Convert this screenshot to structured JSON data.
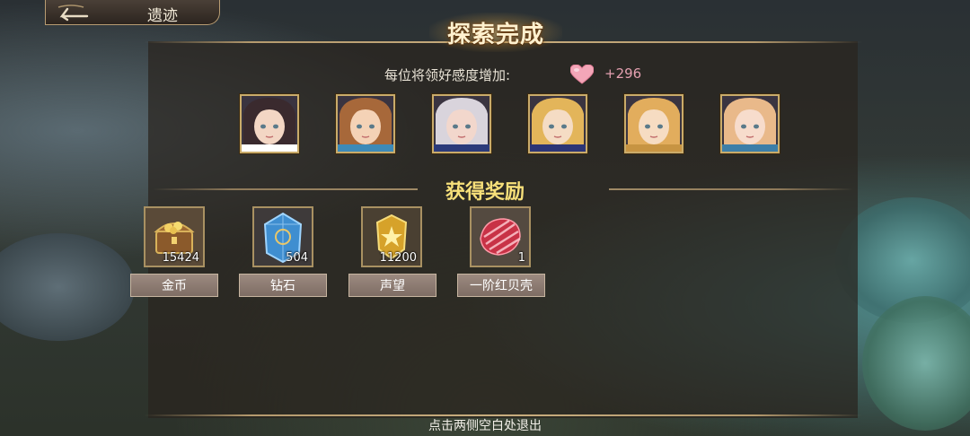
{
  "header": {
    "back_icon": "back-arrow-icon",
    "area_title": "遗迹"
  },
  "banner": {
    "title": "探索完成"
  },
  "affection": {
    "label": "每位将领好感度增加:",
    "icon": "heart-icon",
    "value": "+296"
  },
  "portraits": [
    {
      "name": "portrait-1",
      "hair": "#3a2a2e",
      "skin": "#f3d6c4",
      "accent": "#ffffff"
    },
    {
      "name": "portrait-2",
      "hair": "#a7683a",
      "skin": "#f4d2b6",
      "accent": "#3d8ab8"
    },
    {
      "name": "portrait-3",
      "hair": "#d9d4dc",
      "skin": "#f2d7cc",
      "accent": "#2b3a7a"
    },
    {
      "name": "portrait-4",
      "hair": "#e3b55a",
      "skin": "#f5dcc4",
      "accent": "#2c3576"
    },
    {
      "name": "portrait-5",
      "hair": "#e2ad5d",
      "skin": "#f6dcc2",
      "accent": "#c79442"
    },
    {
      "name": "portrait-6",
      "hair": "#e9b98a",
      "skin": "#f7dccc",
      "accent": "#3c7ea8"
    }
  ],
  "rewards": {
    "title": "获得奖励",
    "items": [
      {
        "icon": "treasure-chest-icon",
        "count": "15424",
        "label": "金币"
      },
      {
        "icon": "diamond-crystal-icon",
        "count": "504",
        "label": "钻石"
      },
      {
        "icon": "prestige-badge-icon",
        "count": "11200",
        "label": "声望"
      },
      {
        "icon": "red-shell-icon",
        "count": "1",
        "label": "一阶红贝壳"
      }
    ]
  },
  "footer": {
    "hint": "点击两侧空白处退出"
  }
}
